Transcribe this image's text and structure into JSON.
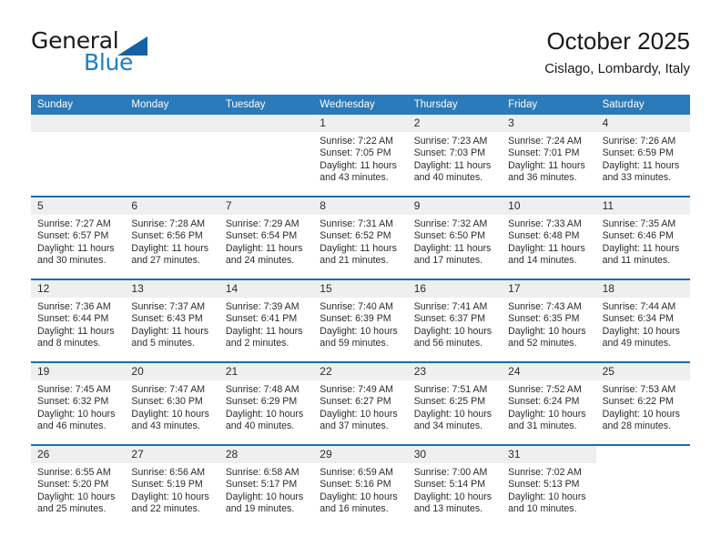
{
  "brand": {
    "name_part1": "General",
    "name_part2": "Blue",
    "logo_icon": "triangle-logo-icon"
  },
  "header": {
    "title": "October 2025",
    "subtitle": "Cislago, Lombardy, Italy"
  },
  "colors": {
    "header_blue": "#2b7ab9",
    "rule_blue": "#1f6bb0",
    "brand_blue": "#1b7fc4",
    "numband_gray": "#efefef",
    "text": "#2b2b2b"
  },
  "weekdays": [
    "Sunday",
    "Monday",
    "Tuesday",
    "Wednesday",
    "Thursday",
    "Friday",
    "Saturday"
  ],
  "labels": {
    "sunrise": "Sunrise:",
    "sunset": "Sunset:",
    "daylight": "Daylight:"
  },
  "weeks": [
    [
      {
        "day": "",
        "blank": true
      },
      {
        "day": "",
        "blank": true
      },
      {
        "day": "",
        "blank": true
      },
      {
        "day": "1",
        "sunrise": "Sunrise: 7:22 AM",
        "sunset": "Sunset: 7:05 PM",
        "daylight_l1": "Daylight: 11 hours",
        "daylight_l2": "and 43 minutes."
      },
      {
        "day": "2",
        "sunrise": "Sunrise: 7:23 AM",
        "sunset": "Sunset: 7:03 PM",
        "daylight_l1": "Daylight: 11 hours",
        "daylight_l2": "and 40 minutes."
      },
      {
        "day": "3",
        "sunrise": "Sunrise: 7:24 AM",
        "sunset": "Sunset: 7:01 PM",
        "daylight_l1": "Daylight: 11 hours",
        "daylight_l2": "and 36 minutes."
      },
      {
        "day": "4",
        "sunrise": "Sunrise: 7:26 AM",
        "sunset": "Sunset: 6:59 PM",
        "daylight_l1": "Daylight: 11 hours",
        "daylight_l2": "and 33 minutes."
      }
    ],
    [
      {
        "day": "5",
        "sunrise": "Sunrise: 7:27 AM",
        "sunset": "Sunset: 6:57 PM",
        "daylight_l1": "Daylight: 11 hours",
        "daylight_l2": "and 30 minutes."
      },
      {
        "day": "6",
        "sunrise": "Sunrise: 7:28 AM",
        "sunset": "Sunset: 6:56 PM",
        "daylight_l1": "Daylight: 11 hours",
        "daylight_l2": "and 27 minutes."
      },
      {
        "day": "7",
        "sunrise": "Sunrise: 7:29 AM",
        "sunset": "Sunset: 6:54 PM",
        "daylight_l1": "Daylight: 11 hours",
        "daylight_l2": "and 24 minutes."
      },
      {
        "day": "8",
        "sunrise": "Sunrise: 7:31 AM",
        "sunset": "Sunset: 6:52 PM",
        "daylight_l1": "Daylight: 11 hours",
        "daylight_l2": "and 21 minutes."
      },
      {
        "day": "9",
        "sunrise": "Sunrise: 7:32 AM",
        "sunset": "Sunset: 6:50 PM",
        "daylight_l1": "Daylight: 11 hours",
        "daylight_l2": "and 17 minutes."
      },
      {
        "day": "10",
        "sunrise": "Sunrise: 7:33 AM",
        "sunset": "Sunset: 6:48 PM",
        "daylight_l1": "Daylight: 11 hours",
        "daylight_l2": "and 14 minutes."
      },
      {
        "day": "11",
        "sunrise": "Sunrise: 7:35 AM",
        "sunset": "Sunset: 6:46 PM",
        "daylight_l1": "Daylight: 11 hours",
        "daylight_l2": "and 11 minutes."
      }
    ],
    [
      {
        "day": "12",
        "sunrise": "Sunrise: 7:36 AM",
        "sunset": "Sunset: 6:44 PM",
        "daylight_l1": "Daylight: 11 hours",
        "daylight_l2": "and 8 minutes."
      },
      {
        "day": "13",
        "sunrise": "Sunrise: 7:37 AM",
        "sunset": "Sunset: 6:43 PM",
        "daylight_l1": "Daylight: 11 hours",
        "daylight_l2": "and 5 minutes."
      },
      {
        "day": "14",
        "sunrise": "Sunrise: 7:39 AM",
        "sunset": "Sunset: 6:41 PM",
        "daylight_l1": "Daylight: 11 hours",
        "daylight_l2": "and 2 minutes."
      },
      {
        "day": "15",
        "sunrise": "Sunrise: 7:40 AM",
        "sunset": "Sunset: 6:39 PM",
        "daylight_l1": "Daylight: 10 hours",
        "daylight_l2": "and 59 minutes."
      },
      {
        "day": "16",
        "sunrise": "Sunrise: 7:41 AM",
        "sunset": "Sunset: 6:37 PM",
        "daylight_l1": "Daylight: 10 hours",
        "daylight_l2": "and 56 minutes."
      },
      {
        "day": "17",
        "sunrise": "Sunrise: 7:43 AM",
        "sunset": "Sunset: 6:35 PM",
        "daylight_l1": "Daylight: 10 hours",
        "daylight_l2": "and 52 minutes."
      },
      {
        "day": "18",
        "sunrise": "Sunrise: 7:44 AM",
        "sunset": "Sunset: 6:34 PM",
        "daylight_l1": "Daylight: 10 hours",
        "daylight_l2": "and 49 minutes."
      }
    ],
    [
      {
        "day": "19",
        "sunrise": "Sunrise: 7:45 AM",
        "sunset": "Sunset: 6:32 PM",
        "daylight_l1": "Daylight: 10 hours",
        "daylight_l2": "and 46 minutes."
      },
      {
        "day": "20",
        "sunrise": "Sunrise: 7:47 AM",
        "sunset": "Sunset: 6:30 PM",
        "daylight_l1": "Daylight: 10 hours",
        "daylight_l2": "and 43 minutes."
      },
      {
        "day": "21",
        "sunrise": "Sunrise: 7:48 AM",
        "sunset": "Sunset: 6:29 PM",
        "daylight_l1": "Daylight: 10 hours",
        "daylight_l2": "and 40 minutes."
      },
      {
        "day": "22",
        "sunrise": "Sunrise: 7:49 AM",
        "sunset": "Sunset: 6:27 PM",
        "daylight_l1": "Daylight: 10 hours",
        "daylight_l2": "and 37 minutes."
      },
      {
        "day": "23",
        "sunrise": "Sunrise: 7:51 AM",
        "sunset": "Sunset: 6:25 PM",
        "daylight_l1": "Daylight: 10 hours",
        "daylight_l2": "and 34 minutes."
      },
      {
        "day": "24",
        "sunrise": "Sunrise: 7:52 AM",
        "sunset": "Sunset: 6:24 PM",
        "daylight_l1": "Daylight: 10 hours",
        "daylight_l2": "and 31 minutes."
      },
      {
        "day": "25",
        "sunrise": "Sunrise: 7:53 AM",
        "sunset": "Sunset: 6:22 PM",
        "daylight_l1": "Daylight: 10 hours",
        "daylight_l2": "and 28 minutes."
      }
    ],
    [
      {
        "day": "26",
        "sunrise": "Sunrise: 6:55 AM",
        "sunset": "Sunset: 5:20 PM",
        "daylight_l1": "Daylight: 10 hours",
        "daylight_l2": "and 25 minutes."
      },
      {
        "day": "27",
        "sunrise": "Sunrise: 6:56 AM",
        "sunset": "Sunset: 5:19 PM",
        "daylight_l1": "Daylight: 10 hours",
        "daylight_l2": "and 22 minutes."
      },
      {
        "day": "28",
        "sunrise": "Sunrise: 6:58 AM",
        "sunset": "Sunset: 5:17 PM",
        "daylight_l1": "Daylight: 10 hours",
        "daylight_l2": "and 19 minutes."
      },
      {
        "day": "29",
        "sunrise": "Sunrise: 6:59 AM",
        "sunset": "Sunset: 5:16 PM",
        "daylight_l1": "Daylight: 10 hours",
        "daylight_l2": "and 16 minutes."
      },
      {
        "day": "30",
        "sunrise": "Sunrise: 7:00 AM",
        "sunset": "Sunset: 5:14 PM",
        "daylight_l1": "Daylight: 10 hours",
        "daylight_l2": "and 13 minutes."
      },
      {
        "day": "31",
        "sunrise": "Sunrise: 7:02 AM",
        "sunset": "Sunset: 5:13 PM",
        "daylight_l1": "Daylight: 10 hours",
        "daylight_l2": "and 10 minutes."
      },
      {
        "day": "",
        "blank": true,
        "trailing": true
      }
    ]
  ]
}
